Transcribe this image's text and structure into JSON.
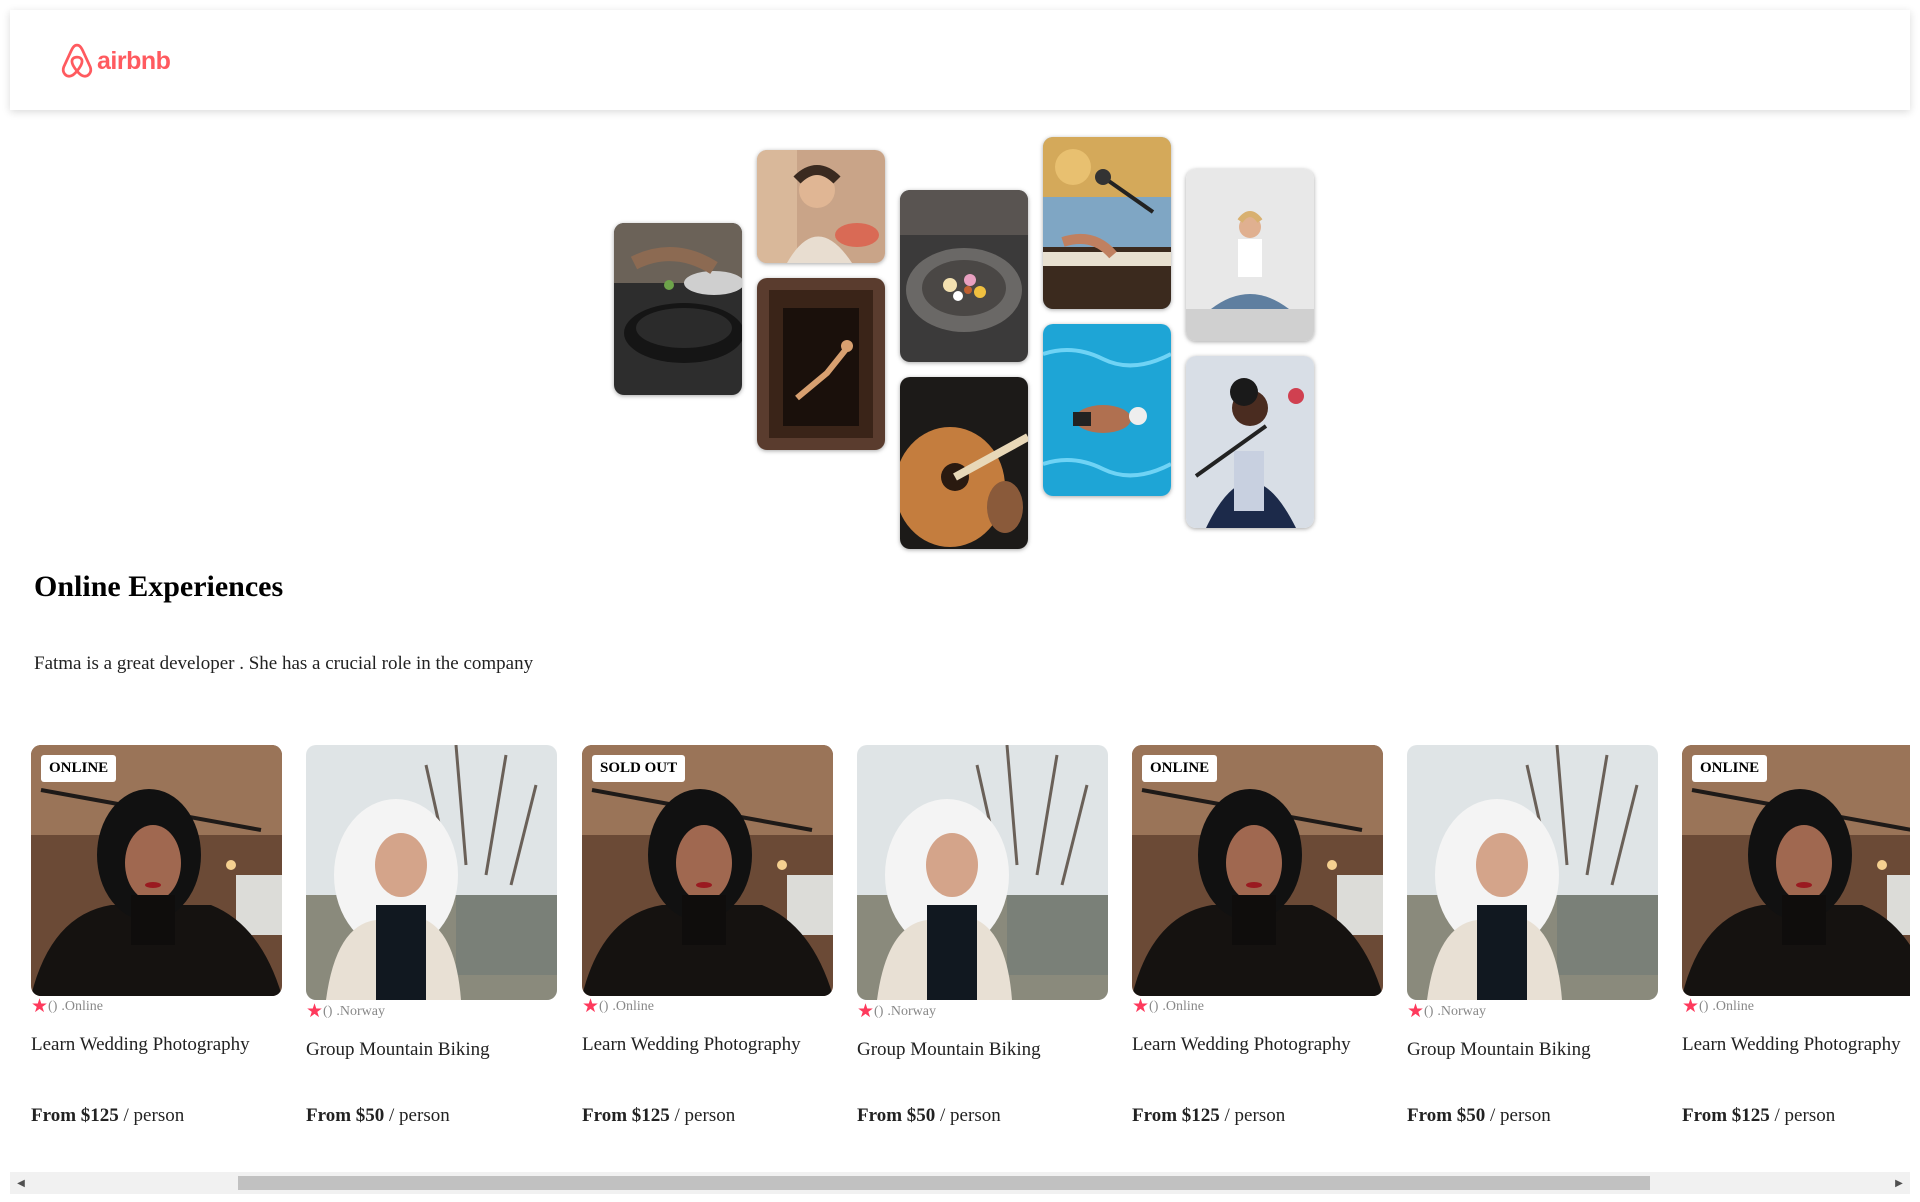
{
  "navbar": {
    "logo_text": "airbnb",
    "brand_color": "#FF5A5F"
  },
  "hero": {
    "image_subjects": [
      "cooking pans",
      "woman holding food",
      "dancer in doorway",
      "food bowl",
      "guitar playing",
      "piano with microphone",
      "swimmer in pool",
      "woman meditating",
      "singer with microphone"
    ]
  },
  "section": {
    "title": "Online Experiences",
    "description": "Fatma is a great developer . She has a crucial role in the company"
  },
  "cards": [
    {
      "badge": "ONLINE",
      "rating_count": "()",
      "location": ".Online",
      "title": "Learn Wedding Photography",
      "price_label": "From $125",
      "price_unit": "/ person",
      "photo": "woman-indoor"
    },
    {
      "badge": "",
      "rating_count": "()",
      "location": ".Norway",
      "title": "Group Mountain Biking",
      "price_label": "From $50",
      "price_unit": "/ person",
      "photo": "woman-fur-hood"
    },
    {
      "badge": "SOLD OUT",
      "rating_count": "()",
      "location": ".Online",
      "title": "Learn Wedding Photography",
      "price_label": "From $125",
      "price_unit": "/ person",
      "photo": "woman-indoor"
    },
    {
      "badge": "",
      "rating_count": "()",
      "location": ".Norway",
      "title": "Group Mountain Biking",
      "price_label": "From $50",
      "price_unit": "/ person",
      "photo": "woman-fur-hood"
    },
    {
      "badge": "ONLINE",
      "rating_count": "()",
      "location": ".Online",
      "title": "Learn Wedding Photography",
      "price_label": "From $125",
      "price_unit": "/ person",
      "photo": "woman-indoor"
    },
    {
      "badge": "",
      "rating_count": "()",
      "location": ".Norway",
      "title": "Group Mountain Biking",
      "price_label": "From $50",
      "price_unit": "/ person",
      "photo": "woman-fur-hood"
    },
    {
      "badge": "ONLINE",
      "rating_count": "()",
      "location": ".Online",
      "title": "Learn Wedding Photography",
      "price_label": "From $125",
      "price_unit": "/ person",
      "photo": "woman-indoor"
    }
  ],
  "colors": {
    "star": "#FE395C",
    "text": "#222222",
    "muted": "#888888"
  },
  "scrollbar": {
    "left_arrow": "◀",
    "right_arrow": "▶"
  }
}
